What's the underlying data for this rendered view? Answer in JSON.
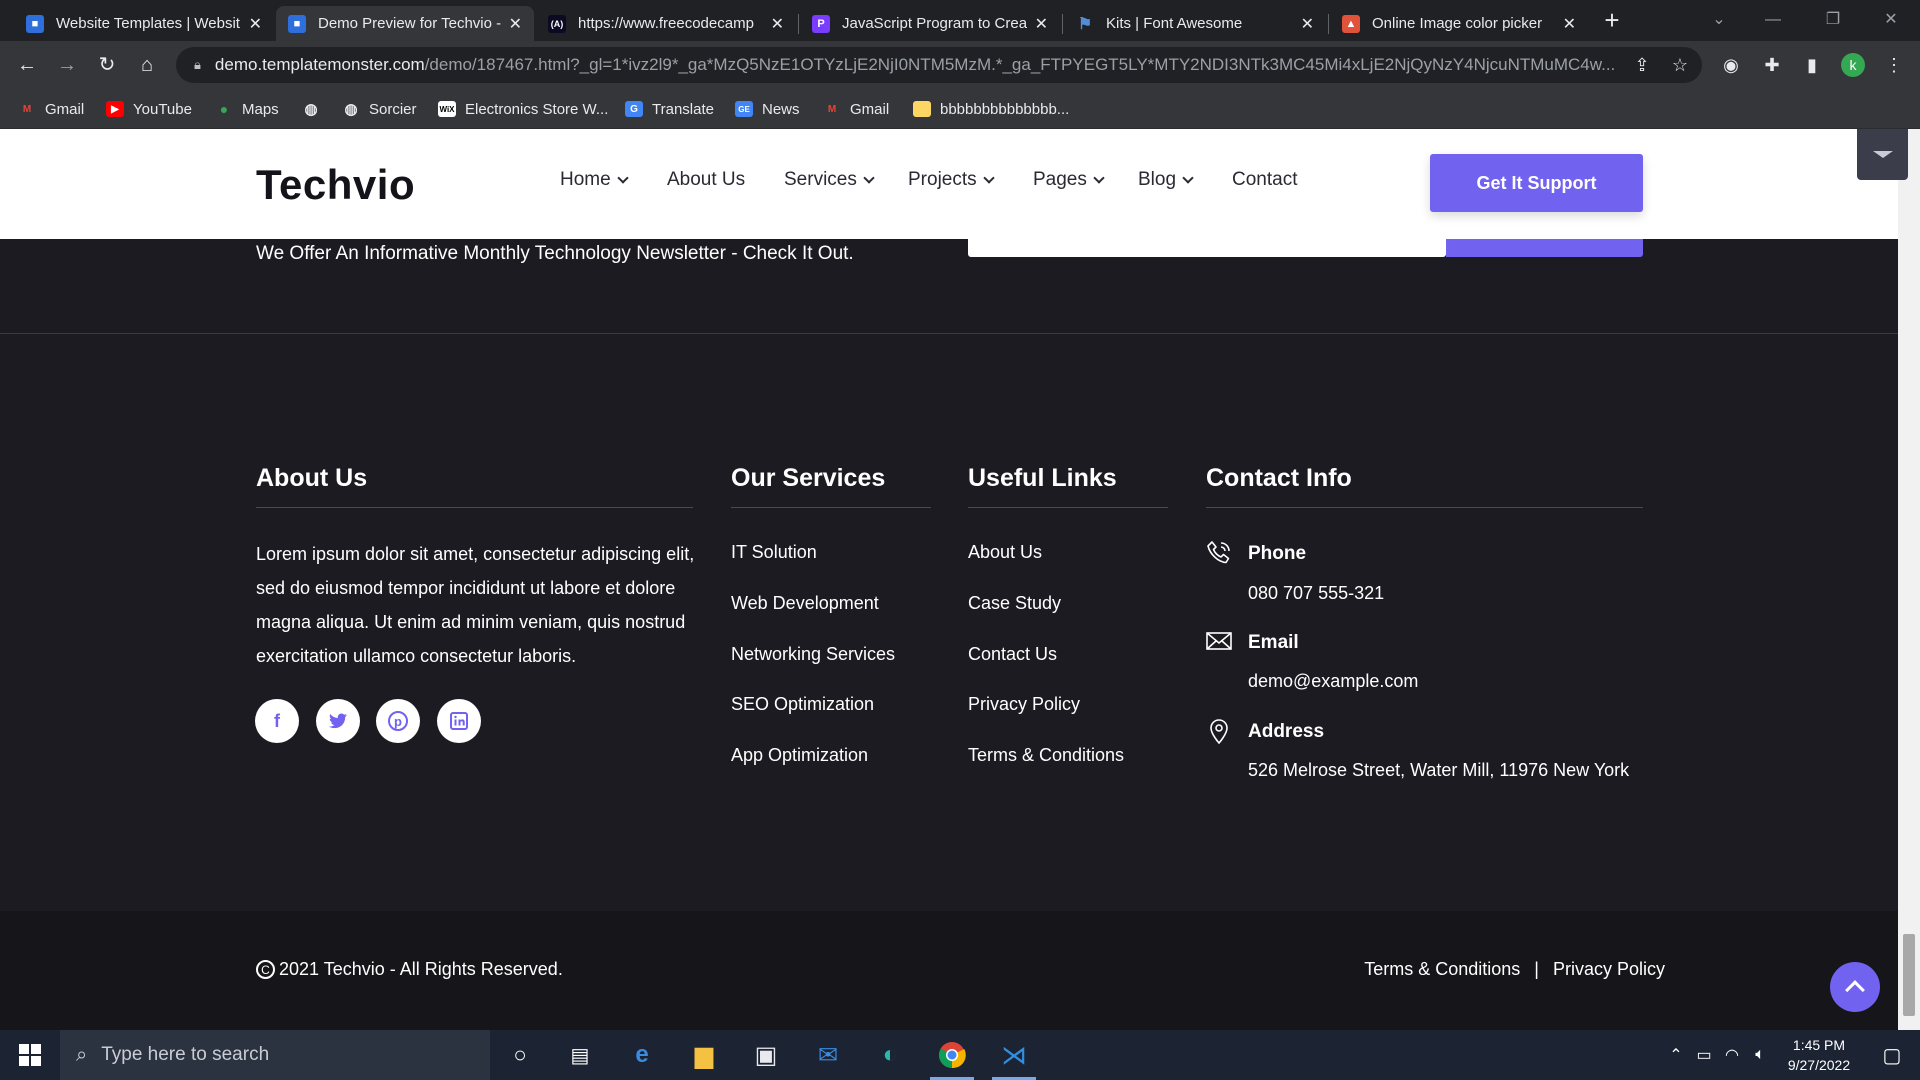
{
  "browser": {
    "tabs": [
      {
        "title": "Website Templates | Websit",
        "favicon_color": "#2f6fdb",
        "active": false
      },
      {
        "title": "Demo Preview for Techvio - ",
        "favicon_color": "#2f6fdb",
        "active": true
      },
      {
        "title": "https://www.freecodecamp",
        "favicon_color": "#0a0a23",
        "active": false
      },
      {
        "title": "JavaScript Program to Creat",
        "favicon_color": "#7a3cff",
        "active": false
      },
      {
        "title": "Kits | Font Awesome",
        "favicon_color": "#528dd7",
        "active": false
      },
      {
        "title": "Online Image color picker",
        "favicon_color": "#e0523a",
        "active": false
      }
    ],
    "url_host": "demo.templatemonster.com",
    "url_path": "/demo/187467.html?_gl=1*ivz2l9*_ga*MzQ5NzE1OTYzLjE2NjI0NTM5MzM.*_ga_FTPYEGT5LY*MTY2NDI3NTk3MC45Mi4xLjE2NjQyNzY4NjcuNTMuMC4w...",
    "profile_initial": "k",
    "bookmarks": [
      {
        "label": "Gmail",
        "icon": "gmail-icon",
        "color": "#ea4335"
      },
      {
        "label": "YouTube",
        "icon": "youtube-icon",
        "color": "#ff0000"
      },
      {
        "label": "Maps",
        "icon": "maps-icon",
        "color": "#34a853"
      },
      {
        "label": "",
        "icon": "globe-icon",
        "color": "#e8eaed"
      },
      {
        "label": "Sorcier",
        "icon": "globe-icon",
        "color": "#e8eaed"
      },
      {
        "label": "Electronics Store W...",
        "icon": "wix-icon",
        "color": "#ffffff"
      },
      {
        "label": "Translate",
        "icon": "translate-icon",
        "color": "#4285f4"
      },
      {
        "label": "News",
        "icon": "news-icon",
        "color": "#4285f4"
      },
      {
        "label": "Gmail",
        "icon": "gmail-icon",
        "color": "#ea4335"
      },
      {
        "label": "bbbbbbbbbbbbbb...",
        "icon": "folder-icon",
        "color": "#fdd663"
      }
    ]
  },
  "site": {
    "logo": "Techvio",
    "nav": [
      {
        "label": "Home",
        "dropdown": true
      },
      {
        "label": "About Us",
        "dropdown": false
      },
      {
        "label": "Services",
        "dropdown": true
      },
      {
        "label": "Projects",
        "dropdown": true
      },
      {
        "label": "Pages",
        "dropdown": true
      },
      {
        "label": "Blog",
        "dropdown": true
      },
      {
        "label": "Contact",
        "dropdown": false
      }
    ],
    "cta": "Get It Support",
    "newsletter_text": "We Offer An Informative Monthly Technology Newsletter - Check It Out.",
    "accent_color": "#7162f0"
  },
  "footer": {
    "about": {
      "title": "About Us",
      "text": "Lorem ipsum dolor sit amet, consectetur adipiscing elit, sed do eiusmod tempor incididunt ut labore et dolore magna aliqua. Ut enim ad minim veniam, quis nostrud exercitation ullamco consectetur laboris.",
      "social": [
        {
          "icon": "facebook-icon",
          "glyph": "f"
        },
        {
          "icon": "twitter-icon",
          "glyph": "t"
        },
        {
          "icon": "pinterest-icon",
          "glyph": "p"
        },
        {
          "icon": "linkedin-icon",
          "glyph": "in"
        }
      ]
    },
    "services": {
      "title": "Our Services",
      "links": [
        "IT Solution",
        "Web Development",
        "Networking Services",
        "SEO Optimization",
        "App Optimization"
      ]
    },
    "useful": {
      "title": "Useful Links",
      "links": [
        "About Us",
        "Case Study",
        "Contact Us",
        "Privacy Policy",
        "Terms & Conditions"
      ]
    },
    "contact": {
      "title": "Contact Info",
      "items": [
        {
          "label": "Phone",
          "value": "080 707 555-321",
          "icon": "phone-icon"
        },
        {
          "label": "Email",
          "value": "demo@example.com",
          "icon": "envelope-icon"
        },
        {
          "label": "Address",
          "value": "526 Melrose Street, Water Mill, 11976 New York",
          "icon": "map-pin-icon"
        }
      ]
    },
    "copyright": "2021 Techvio - All Rights Reserved.",
    "bottom_links": [
      "Terms & Conditions",
      "Privacy Policy"
    ]
  },
  "taskbar": {
    "search_placeholder": "Type here to search",
    "time": "1:45 PM",
    "date": "9/27/2022"
  }
}
